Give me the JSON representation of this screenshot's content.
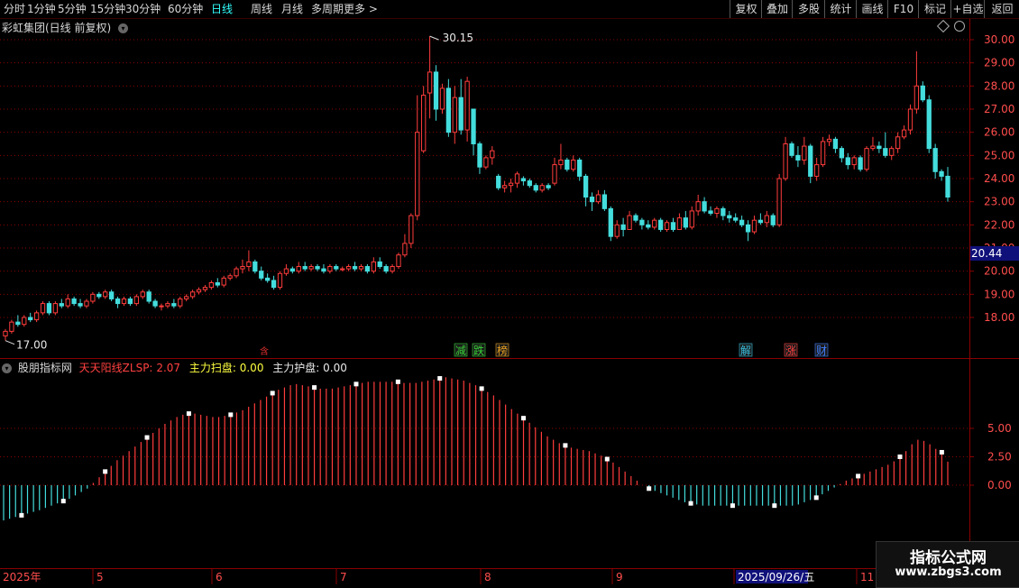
{
  "toolbar": {
    "periods": [
      "分时",
      "1分钟",
      "5分钟",
      "15分钟",
      "30分钟",
      "60分钟",
      "日线",
      "周线",
      "月线",
      "多周期",
      "更多 >"
    ],
    "active_period": "日线",
    "actions": [
      "复权",
      "叠加",
      "多股",
      "统计",
      "画线",
      "F10",
      "标记",
      "+自选",
      "返回"
    ]
  },
  "main_panel": {
    "title": "彩虹集团(日线 前复权)",
    "high_label": "30.15",
    "low_label": "17.00",
    "current_price": "20.44",
    "price_ticks": [
      "30.00",
      "29.00",
      "28.00",
      "27.00",
      "26.00",
      "25.00",
      "24.00",
      "23.00",
      "22.00",
      "21.00",
      "20.00",
      "19.00",
      "18.00"
    ],
    "event_badges": [
      {
        "text": "减",
        "color": "#36d336"
      },
      {
        "text": "跌",
        "color": "#36d336"
      },
      {
        "text": "榜",
        "color": "#e8a020"
      },
      {
        "text": "解",
        "color": "#38c0e0"
      },
      {
        "text": "涨",
        "color": "#ff4040"
      },
      {
        "text": "财",
        "color": "#4080ff"
      }
    ],
    "marker_char": "含"
  },
  "indicator_panel": {
    "source": "股朋指标网",
    "line1_label": "天天阳线ZLSP:",
    "line1_value": "2.07",
    "line2_label": "主力扫盘:",
    "line2_value": "0.00",
    "line3_label": "主力护盘:",
    "line3_value": "0.00",
    "ticks": [
      "5.00",
      "2.50",
      "0.00"
    ]
  },
  "date_axis": {
    "labels": [
      "2025年",
      "5",
      "6",
      "7",
      "8",
      "9",
      "2025/09/26/五",
      "11"
    ]
  },
  "watermark": {
    "line1": "指标公式网",
    "line2": "www.zbgs3.com"
  },
  "colors": {
    "up": "#ff3c3c",
    "down": "#44dddd",
    "grid": "#8a0000",
    "axis_text": "#ff4d4d",
    "label_yellow": "#ffff40"
  },
  "chart_data": {
    "type": "candlestick",
    "title": "彩虹集团(日线 前复权)",
    "ylim": [
      17.0,
      30.3
    ],
    "x": [
      "2025年",
      "5",
      "6",
      "7",
      "8",
      "9",
      "2025/09/26/五",
      "11"
    ],
    "candles_ohlc": [
      [
        17.2,
        17.5,
        17.0,
        17.4
      ],
      [
        17.4,
        17.9,
        17.3,
        17.8
      ],
      [
        17.8,
        18.1,
        17.6,
        17.7
      ],
      [
        17.7,
        18.1,
        17.6,
        18.0
      ],
      [
        18.0,
        18.2,
        17.8,
        17.9
      ],
      [
        17.9,
        18.3,
        17.8,
        18.2
      ],
      [
        18.2,
        18.7,
        18.1,
        18.6
      ],
      [
        18.6,
        18.7,
        18.1,
        18.2
      ],
      [
        18.2,
        18.7,
        18.1,
        18.6
      ],
      [
        18.6,
        18.8,
        18.4,
        18.5
      ],
      [
        18.5,
        19.0,
        18.4,
        18.8
      ],
      [
        18.8,
        18.9,
        18.5,
        18.6
      ],
      [
        18.6,
        18.8,
        18.4,
        18.5
      ],
      [
        18.5,
        18.8,
        18.4,
        18.7
      ],
      [
        18.7,
        19.1,
        18.6,
        19.0
      ],
      [
        19.0,
        19.1,
        18.8,
        18.9
      ],
      [
        18.9,
        19.2,
        18.8,
        19.1
      ],
      [
        19.1,
        19.2,
        18.7,
        18.8
      ],
      [
        18.8,
        18.9,
        18.4,
        18.6
      ],
      [
        18.6,
        18.9,
        18.5,
        18.8
      ],
      [
        18.8,
        18.9,
        18.5,
        18.6
      ],
      [
        18.6,
        19.0,
        18.5,
        18.9
      ],
      [
        18.9,
        19.2,
        18.8,
        19.1
      ],
      [
        19.1,
        19.2,
        18.6,
        18.7
      ],
      [
        18.7,
        18.8,
        18.4,
        18.5
      ],
      [
        18.5,
        18.6,
        18.3,
        18.5
      ],
      [
        18.5,
        18.7,
        18.4,
        18.6
      ],
      [
        18.6,
        18.8,
        18.4,
        18.5
      ],
      [
        18.5,
        18.9,
        18.4,
        18.8
      ],
      [
        18.8,
        19.0,
        18.7,
        18.9
      ],
      [
        18.9,
        19.2,
        18.8,
        19.1
      ],
      [
        19.1,
        19.3,
        19.0,
        19.2
      ],
      [
        19.2,
        19.4,
        19.1,
        19.3
      ],
      [
        19.3,
        19.6,
        19.2,
        19.5
      ],
      [
        19.5,
        19.7,
        19.3,
        19.4
      ],
      [
        19.4,
        19.8,
        19.3,
        19.7
      ],
      [
        19.7,
        19.9,
        19.6,
        19.8
      ],
      [
        19.8,
        20.2,
        19.7,
        20.1
      ],
      [
        20.1,
        20.5,
        19.9,
        20.2
      ],
      [
        20.2,
        20.9,
        20.0,
        20.4
      ],
      [
        20.4,
        20.5,
        19.9,
        20.0
      ],
      [
        20.0,
        20.2,
        19.6,
        19.7
      ],
      [
        19.7,
        19.9,
        19.5,
        19.6
      ],
      [
        19.6,
        19.8,
        19.2,
        19.3
      ],
      [
        19.3,
        20.0,
        19.2,
        19.9
      ],
      [
        19.9,
        20.3,
        19.8,
        20.1
      ],
      [
        20.1,
        20.2,
        19.9,
        20.0
      ],
      [
        20.0,
        20.4,
        19.9,
        20.2
      ],
      [
        20.2,
        20.4,
        20.0,
        20.1
      ],
      [
        20.1,
        20.3,
        20.0,
        20.2
      ],
      [
        20.2,
        20.3,
        20.0,
        20.1
      ],
      [
        20.1,
        20.3,
        19.9,
        20.0
      ],
      [
        20.0,
        20.3,
        19.9,
        20.2
      ],
      [
        20.2,
        20.3,
        20.0,
        20.1
      ],
      [
        20.1,
        20.2,
        20.0,
        20.1
      ],
      [
        20.1,
        20.3,
        20.0,
        20.2
      ],
      [
        20.2,
        20.4,
        20.0,
        20.1
      ],
      [
        20.1,
        20.3,
        20.0,
        20.2
      ],
      [
        20.2,
        20.3,
        19.9,
        20.0
      ],
      [
        20.0,
        20.6,
        19.9,
        20.4
      ],
      [
        20.4,
        20.6,
        20.1,
        20.2
      ],
      [
        20.2,
        20.3,
        19.9,
        20.0
      ],
      [
        20.0,
        20.3,
        19.9,
        20.2
      ],
      [
        20.2,
        20.8,
        20.1,
        20.7
      ],
      [
        20.7,
        21.6,
        20.6,
        21.2
      ],
      [
        21.2,
        22.5,
        21.0,
        22.4
      ],
      [
        22.4,
        27.6,
        22.2,
        26.0
      ],
      [
        25.2,
        28.0,
        25.1,
        27.6
      ],
      [
        27.7,
        30.15,
        26.6,
        28.6
      ],
      [
        28.6,
        28.9,
        26.5,
        27.0
      ],
      [
        27.0,
        28.1,
        26.8,
        27.9
      ],
      [
        27.9,
        28.3,
        25.8,
        26.0
      ],
      [
        26.0,
        28.0,
        25.5,
        27.5
      ],
      [
        27.5,
        28.3,
        25.9,
        26.1
      ],
      [
        26.1,
        28.4,
        25.6,
        28.2
      ],
      [
        27.0,
        27.0,
        25.0,
        25.5
      ],
      [
        25.5,
        25.6,
        24.2,
        24.5
      ],
      [
        24.5,
        25.0,
        24.4,
        24.9
      ],
      [
        24.9,
        25.4,
        24.6,
        25.2
      ],
      [
        24.1,
        24.2,
        23.5,
        23.6
      ],
      [
        23.6,
        23.9,
        23.4,
        23.7
      ],
      [
        23.7,
        24.0,
        23.4,
        23.8
      ],
      [
        23.8,
        24.3,
        23.6,
        24.2
      ],
      [
        24.0,
        24.1,
        23.7,
        23.9
      ],
      [
        23.9,
        24.0,
        23.6,
        23.7
      ],
      [
        23.7,
        23.8,
        23.4,
        23.5
      ],
      [
        23.5,
        23.8,
        23.4,
        23.7
      ],
      [
        23.7,
        23.8,
        23.5,
        23.6
      ],
      [
        23.8,
        24.9,
        23.7,
        24.6
      ],
      [
        24.6,
        25.5,
        24.4,
        24.8
      ],
      [
        24.8,
        24.9,
        24.3,
        24.4
      ],
      [
        24.4,
        25.0,
        24.3,
        24.8
      ],
      [
        24.8,
        24.9,
        23.9,
        24.1
      ],
      [
        24.1,
        24.2,
        22.8,
        23.2
      ],
      [
        23.2,
        23.4,
        22.6,
        23.0
      ],
      [
        23.0,
        23.5,
        22.9,
        23.3
      ],
      [
        23.3,
        23.5,
        22.6,
        22.7
      ],
      [
        22.7,
        22.8,
        21.3,
        21.5
      ],
      [
        21.5,
        22.2,
        21.4,
        22.0
      ],
      [
        22.0,
        22.3,
        21.5,
        21.8
      ],
      [
        21.8,
        22.6,
        21.8,
        22.4
      ],
      [
        22.4,
        22.5,
        22.1,
        22.2
      ],
      [
        22.2,
        22.3,
        21.8,
        22.0
      ],
      [
        22.0,
        22.2,
        21.8,
        21.9
      ],
      [
        21.9,
        22.3,
        21.8,
        22.2
      ],
      [
        22.2,
        22.3,
        21.7,
        21.8
      ],
      [
        21.8,
        22.2,
        21.7,
        22.1
      ],
      [
        22.1,
        22.3,
        21.7,
        21.8
      ],
      [
        21.8,
        22.5,
        21.8,
        22.3
      ],
      [
        22.3,
        22.6,
        21.8,
        21.9
      ],
      [
        21.9,
        22.8,
        21.8,
        22.6
      ],
      [
        22.6,
        23.3,
        22.4,
        23.0
      ],
      [
        23.0,
        23.2,
        22.5,
        22.6
      ],
      [
        22.6,
        22.8,
        22.4,
        22.5
      ],
      [
        22.5,
        22.8,
        22.3,
        22.7
      ],
      [
        22.7,
        22.8,
        22.2,
        22.4
      ],
      [
        22.4,
        22.6,
        22.1,
        22.3
      ],
      [
        22.3,
        22.5,
        22.1,
        22.2
      ],
      [
        22.2,
        22.4,
        21.9,
        22.0
      ],
      [
        22.0,
        22.2,
        21.3,
        21.7
      ],
      [
        21.7,
        22.4,
        21.6,
        22.2
      ],
      [
        22.2,
        22.5,
        22.0,
        22.1
      ],
      [
        22.1,
        22.6,
        21.9,
        22.4
      ],
      [
        22.4,
        22.5,
        21.9,
        22.0
      ],
      [
        22.0,
        24.2,
        21.9,
        24.0
      ],
      [
        24.0,
        25.8,
        23.9,
        25.5
      ],
      [
        25.5,
        25.6,
        24.9,
        25.0
      ],
      [
        25.0,
        25.4,
        24.5,
        24.8
      ],
      [
        24.8,
        25.8,
        24.6,
        25.4
      ],
      [
        25.4,
        25.5,
        23.8,
        24.1
      ],
      [
        24.1,
        24.9,
        23.9,
        24.6
      ],
      [
        24.6,
        25.8,
        24.5,
        25.6
      ],
      [
        25.6,
        25.9,
        25.4,
        25.7
      ],
      [
        25.7,
        25.8,
        25.1,
        25.3
      ],
      [
        25.3,
        25.4,
        24.7,
        24.9
      ],
      [
        24.9,
        25.1,
        24.4,
        24.6
      ],
      [
        24.6,
        25.0,
        24.4,
        24.9
      ],
      [
        24.9,
        25.0,
        24.3,
        24.4
      ],
      [
        24.4,
        25.4,
        24.3,
        25.3
      ],
      [
        25.3,
        25.8,
        25.2,
        25.4
      ],
      [
        25.4,
        25.6,
        25.1,
        25.3
      ],
      [
        25.3,
        26.0,
        24.9,
        25.0
      ],
      [
        25.0,
        25.4,
        24.8,
        25.3
      ],
      [
        25.3,
        26.0,
        25.1,
        25.8
      ],
      [
        25.8,
        26.3,
        25.7,
        26.1
      ],
      [
        26.1,
        27.2,
        25.9,
        27.0
      ],
      [
        27.0,
        29.5,
        26.8,
        28.0
      ],
      [
        28.0,
        28.2,
        27.3,
        27.4
      ],
      [
        27.4,
        27.6,
        25.1,
        25.3
      ],
      [
        25.3,
        25.5,
        24.0,
        24.3
      ],
      [
        24.3,
        24.4,
        23.9,
        24.1
      ],
      [
        24.1,
        24.5,
        23.0,
        23.2
      ]
    ],
    "indicator": {
      "name": "天天阳线ZLSP",
      "last_value": 2.07,
      "ylim": [
        -3.5,
        9.5
      ],
      "values": [
        -3.1,
        -2.95,
        -2.8,
        -2.65,
        -2.5,
        -2.35,
        -2.2,
        -2.0,
        -1.8,
        -1.6,
        -1.4,
        -1.2,
        -0.9,
        -0.6,
        -0.3,
        0.2,
        0.7,
        1.2,
        1.7,
        2.2,
        2.6,
        3.0,
        3.4,
        3.8,
        4.2,
        4.6,
        5.0,
        5.4,
        5.7,
        6.0,
        6.2,
        6.3,
        6.3,
        6.2,
        6.1,
        6.0,
        6.0,
        6.1,
        6.2,
        6.4,
        6.6,
        6.9,
        7.2,
        7.5,
        7.8,
        8.1,
        8.4,
        8.6,
        8.8,
        8.9,
        8.8,
        8.7,
        8.6,
        8.5,
        8.5,
        8.5,
        8.6,
        8.7,
        8.8,
        8.9,
        9.0,
        9.1,
        9.1,
        9.1,
        9.1,
        9.1,
        9.1,
        9.0,
        9.0,
        9.0,
        9.1,
        9.2,
        9.3,
        9.4,
        9.5,
        9.4,
        9.3,
        9.2,
        9.0,
        8.8,
        8.5,
        8.2,
        7.9,
        7.5,
        7.1,
        6.7,
        6.3,
        5.9,
        5.5,
        5.1,
        4.7,
        4.3,
        4.0,
        3.7,
        3.5,
        3.3,
        3.2,
        3.1,
        3.0,
        2.8,
        2.6,
        2.3,
        2.0,
        1.6,
        1.2,
        0.8,
        0.4,
        0.0,
        -0.3,
        -0.5,
        -0.7,
        -0.9,
        -1.1,
        -1.3,
        -1.5,
        -1.6,
        -1.7,
        -1.8,
        -1.8,
        -1.8,
        -1.8,
        -1.8,
        -1.8,
        -1.8,
        -1.8,
        -1.8,
        -1.8,
        -1.8,
        -1.8,
        -1.8,
        -1.8,
        -1.8,
        -1.8,
        -1.7,
        -1.5,
        -1.3,
        -1.1,
        -0.8,
        -0.5,
        -0.2,
        0.1,
        0.4,
        0.6,
        0.8,
        1.0,
        1.2,
        1.4,
        1.6,
        1.8,
        2.1,
        2.5,
        3.0,
        3.6,
        4.0,
        3.9,
        3.6,
        3.2,
        2.9,
        2.07
      ],
      "marker_every": 7
    }
  }
}
